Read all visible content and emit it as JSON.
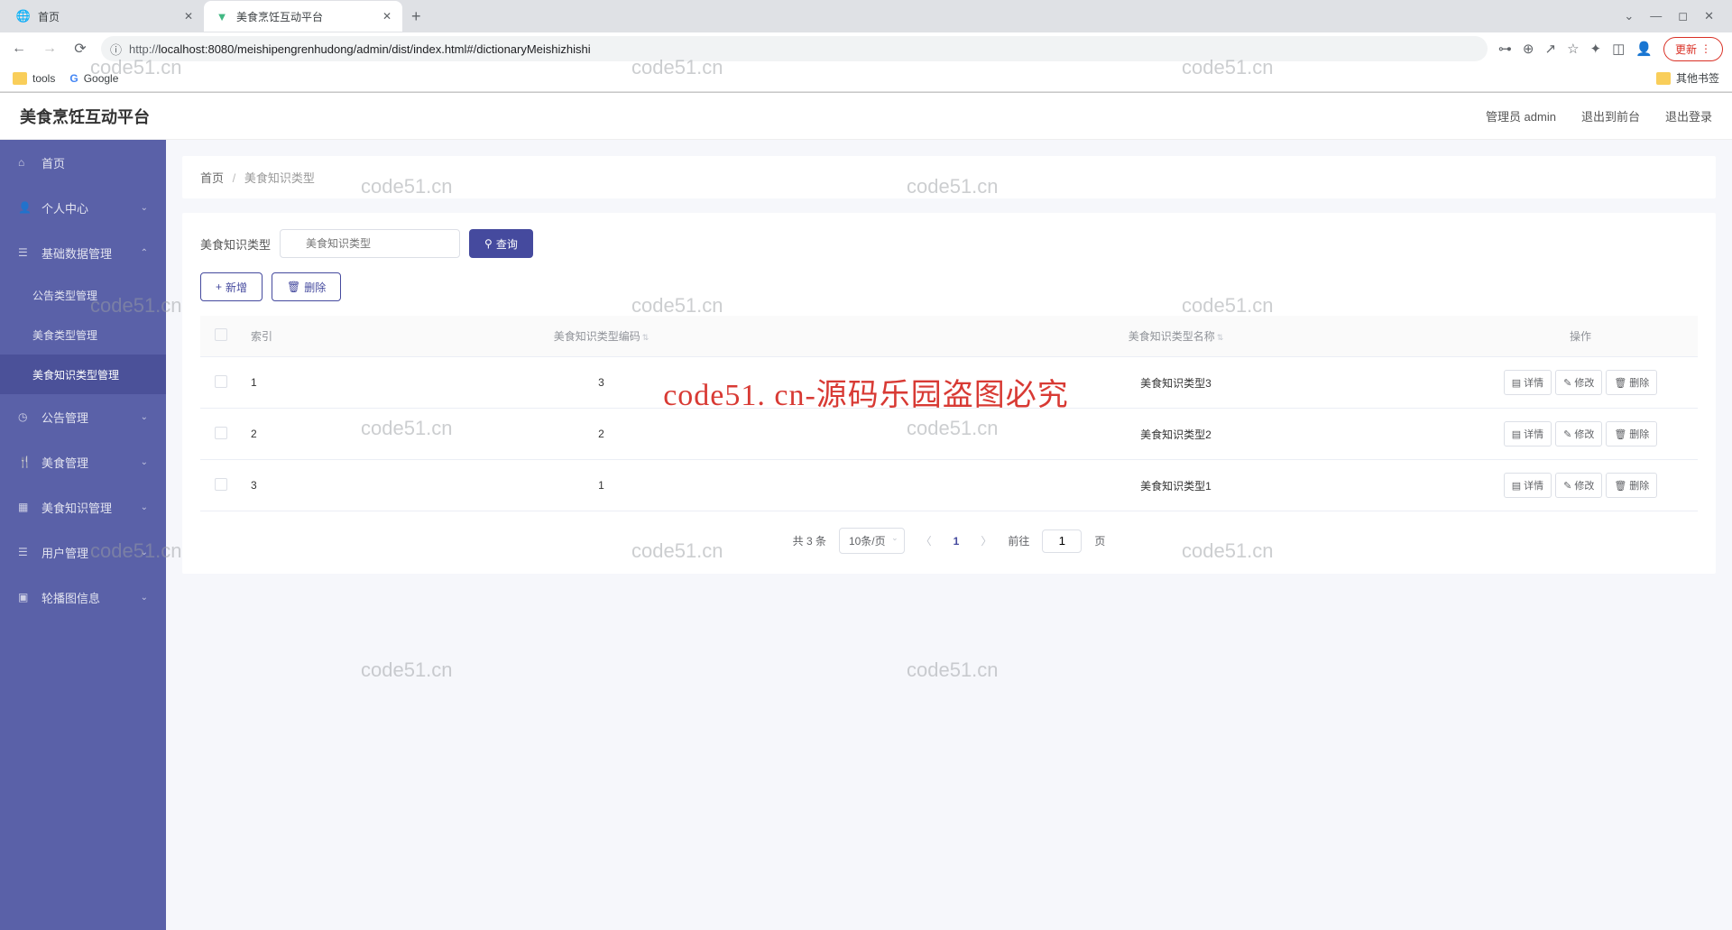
{
  "browser": {
    "tabs": [
      {
        "title": "首页",
        "active": false,
        "favicon": "globe"
      },
      {
        "title": "美食烹饪互动平台",
        "active": true,
        "favicon": "vue"
      }
    ],
    "url_prefix": "http://",
    "url": "localhost:8080/meishipengrenhudong/admin/dist/index.html#/dictionaryMeishizhishi",
    "update_label": "更新",
    "bookmarks": {
      "tools": "tools",
      "google": "Google",
      "other": "其他书签"
    }
  },
  "header": {
    "title": "美食烹饪互动平台",
    "user": "管理员 admin",
    "back_to_front": "退出到前台",
    "logout": "退出登录"
  },
  "sidebar": {
    "home": "首页",
    "personal": "个人中心",
    "base_data": "基础数据管理",
    "sub_notice_type": "公告类型管理",
    "sub_food_type": "美食类型管理",
    "sub_food_knowledge_type": "美食知识类型管理",
    "notice": "公告管理",
    "food": "美食管理",
    "food_knowledge": "美食知识管理",
    "user": "用户管理",
    "carousel": "轮播图信息"
  },
  "breadcrumb": {
    "home": "首页",
    "current": "美食知识类型"
  },
  "search": {
    "label": "美食知识类型",
    "placeholder": "美食知识类型",
    "query_btn": "查询"
  },
  "actions": {
    "add": "新增",
    "delete": "删除"
  },
  "table": {
    "columns": {
      "index": "索引",
      "code": "美食知识类型编码",
      "name": "美食知识类型名称",
      "ops": "操作"
    },
    "ops": {
      "detail": "详情",
      "edit": "修改",
      "delete": "删除"
    },
    "rows": [
      {
        "index": "1",
        "code": "3",
        "name": "美食知识类型3"
      },
      {
        "index": "2",
        "code": "2",
        "name": "美食知识类型2"
      },
      {
        "index": "3",
        "code": "1",
        "name": "美食知识类型1"
      }
    ]
  },
  "pagination": {
    "total_text": "共 3 条",
    "per_page": "10条/页",
    "current": "1",
    "goto_prefix": "前往",
    "goto_suffix": "页",
    "goto_value": "1"
  },
  "watermark_text": "code51.cn",
  "big_watermark": "code51. cn-源码乐园盗图必究"
}
